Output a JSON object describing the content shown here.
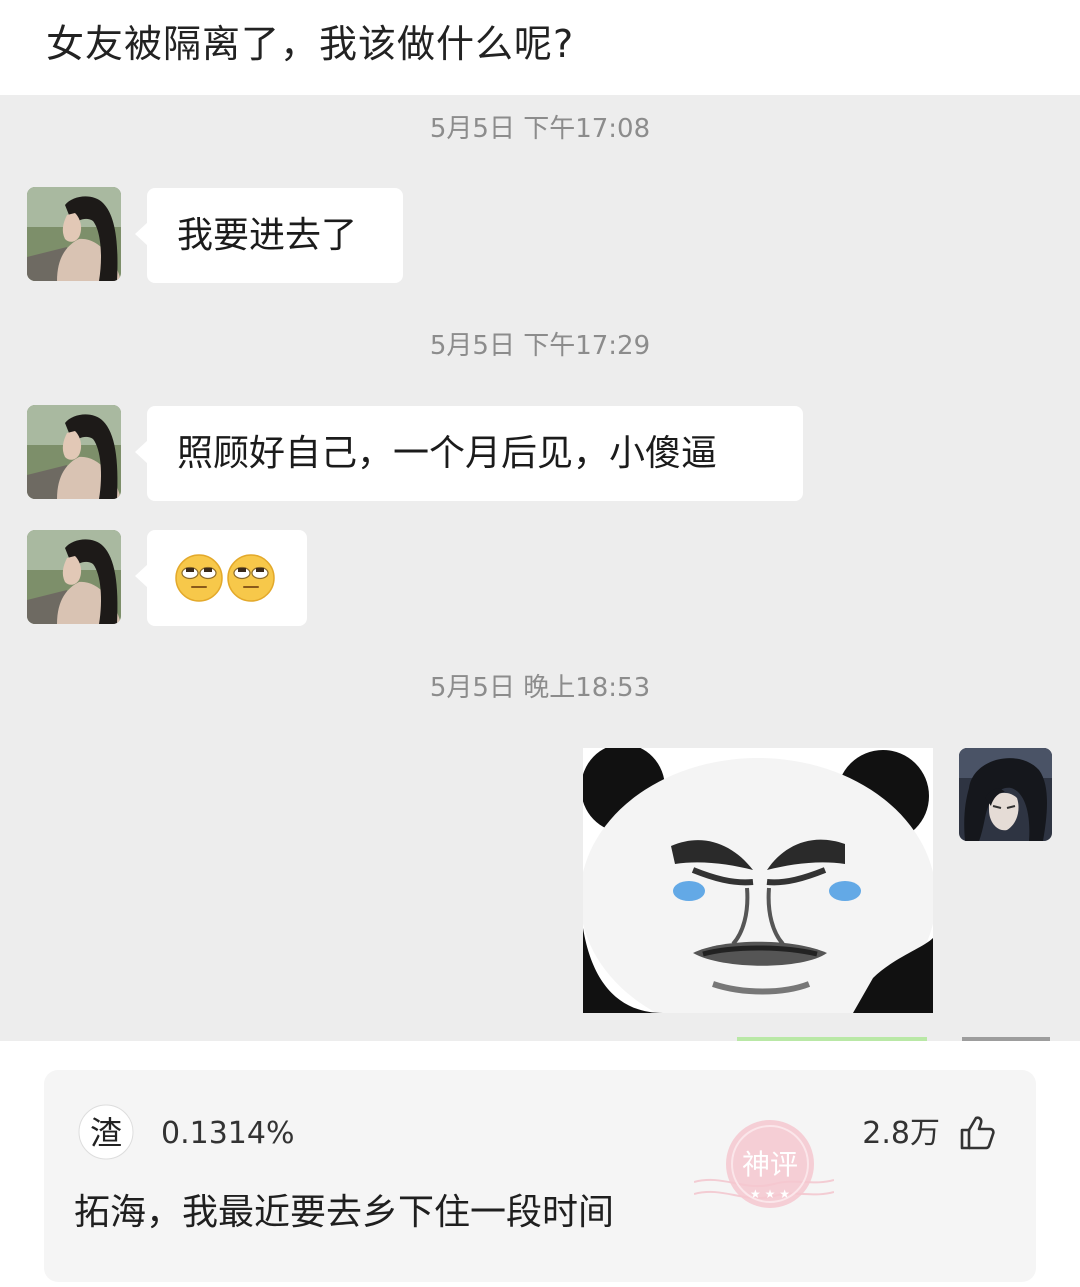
{
  "post": {
    "title": "女友被隔离了，我该做什么呢?"
  },
  "chat": {
    "messages": [
      {
        "timestamp": "5月5日 下午17:08",
        "text": "我要进去了"
      },
      {
        "timestamp": "5月5日 下午17:29",
        "text": "照顾好自己，一个月后见，小傻逼"
      },
      {
        "timestamp": "5月5日 晚上18:53"
      }
    ],
    "emoji_reply": [
      "eye-roll-emoji",
      "eye-roll-emoji"
    ],
    "colors": {
      "background": "#ededed",
      "bubble": "#ffffff",
      "sender_bubble": "#95ec69"
    }
  },
  "comment": {
    "username": "0.1314%",
    "likes": "2.8万",
    "text": "拓海，我最近要去乡下住一段时间",
    "badge_glyphs": "神评",
    "icons": {
      "like": "thumbs-up-icon",
      "badge": "divine-comment-stamp"
    },
    "colors": {
      "badge": "#e8a3ad"
    }
  }
}
